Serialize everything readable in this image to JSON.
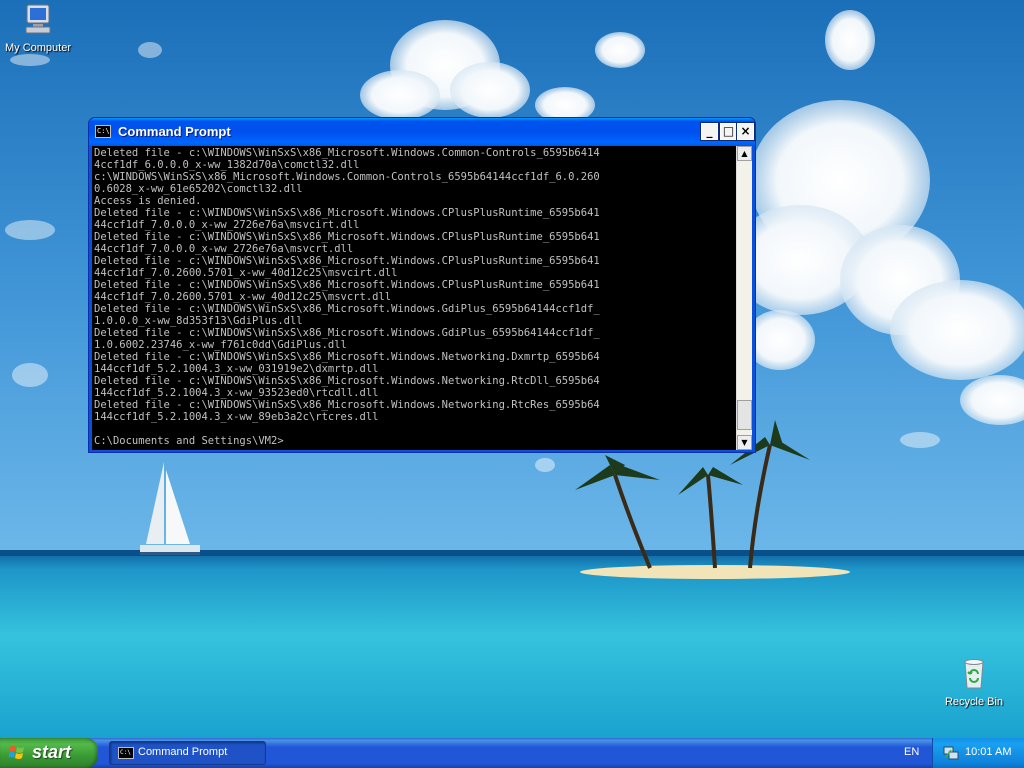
{
  "desktop": {
    "icons": [
      {
        "label": "My Computer"
      },
      {
        "label": "Recycle Bin"
      }
    ]
  },
  "cmd_window": {
    "title": "Command Prompt",
    "minimize_glyph": "_",
    "maximize_glyph": "□",
    "close_glyph": "×",
    "output": "Deleted file - c:\\WINDOWS\\WinSxS\\x86_Microsoft.Windows.Common-Controls_6595b6414\n4ccf1df_6.0.0.0_x-ww_1382d70a\\comctl32.dll\nc:\\WINDOWS\\WinSxS\\x86_Microsoft.Windows.Common-Controls_6595b64144ccf1df_6.0.260\n0.6028_x-ww_61e65202\\comctl32.dll\nAccess is denied.\nDeleted file - c:\\WINDOWS\\WinSxS\\x86_Microsoft.Windows.CPlusPlusRuntime_6595b641\n44ccf1df_7.0.0.0_x-ww_2726e76a\\msvcirt.dll\nDeleted file - c:\\WINDOWS\\WinSxS\\x86_Microsoft.Windows.CPlusPlusRuntime_6595b641\n44ccf1df_7.0.0.0_x-ww_2726e76a\\msvcrt.dll\nDeleted file - c:\\WINDOWS\\WinSxS\\x86_Microsoft.Windows.CPlusPlusRuntime_6595b641\n44ccf1df_7.0.2600.5701_x-ww_40d12c25\\msvcirt.dll\nDeleted file - c:\\WINDOWS\\WinSxS\\x86_Microsoft.Windows.CPlusPlusRuntime_6595b641\n44ccf1df_7.0.2600.5701_x-ww_40d12c25\\msvcrt.dll\nDeleted file - c:\\WINDOWS\\WinSxS\\x86_Microsoft.Windows.GdiPlus_6595b64144ccf1df_\n1.0.0.0_x-ww_8d353f13\\GdiPlus.dll\nDeleted file - c:\\WINDOWS\\WinSxS\\x86_Microsoft.Windows.GdiPlus_6595b64144ccf1df_\n1.0.6002.23746_x-ww_f761c0dd\\GdiPlus.dll\nDeleted file - c:\\WINDOWS\\WinSxS\\x86_Microsoft.Windows.Networking.Dxmrtp_6595b64\n144ccf1df_5.2.1004.3_x-ww_031919e2\\dxmrtp.dll\nDeleted file - c:\\WINDOWS\\WinSxS\\x86_Microsoft.Windows.Networking.RtcDll_6595b64\n144ccf1df_5.2.1004.3_x-ww_93523ed0\\rtcdll.dll\nDeleted file - c:\\WINDOWS\\WinSxS\\x86_Microsoft.Windows.Networking.RtcRes_6595b64\n144ccf1df_5.2.1004.3_x-ww_89eb3a2c\\rtcres.dll\n\nC:\\Documents and Settings\\VM2>"
  },
  "taskbar": {
    "start_label": "start",
    "tasks": [
      {
        "label": "Command Prompt"
      }
    ],
    "language": "EN",
    "clock": "10:01 AM"
  },
  "colors": {
    "titlebar_blue": "#0053ee",
    "taskbar_blue": "#2157d7",
    "start_green": "#3a9a34",
    "console_bg": "#000000",
    "console_fg": "#c0c0c0"
  }
}
